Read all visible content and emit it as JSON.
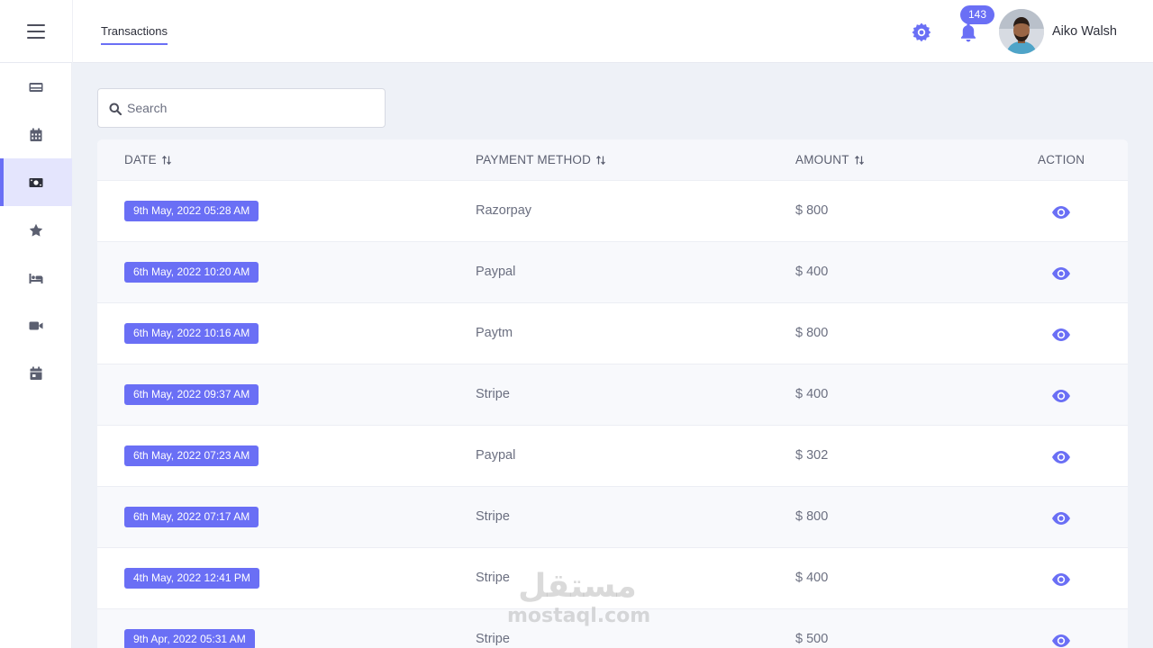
{
  "header": {
    "page_tab": "Transactions",
    "notification_count": "143",
    "user_name": "Aiko Walsh"
  },
  "sidebar": {
    "items": [
      {
        "icon": "credit-card-icon",
        "active": false
      },
      {
        "icon": "calendar-grid-icon",
        "active": false
      },
      {
        "icon": "money-icon",
        "active": true
      },
      {
        "icon": "star-icon",
        "active": false
      },
      {
        "icon": "bed-icon",
        "active": false
      },
      {
        "icon": "video-icon",
        "active": false
      },
      {
        "icon": "calendar-day-icon",
        "active": false
      }
    ]
  },
  "search": {
    "placeholder": "Search",
    "value": ""
  },
  "table": {
    "columns": [
      "DATE",
      "PAYMENT METHOD",
      "AMOUNT",
      "ACTION"
    ],
    "rows": [
      {
        "date": "9th May, 2022 05:28 AM",
        "method": "Razorpay",
        "amount": "$ 800"
      },
      {
        "date": "6th May, 2022 10:20 AM",
        "method": "Paypal",
        "amount": "$ 400"
      },
      {
        "date": "6th May, 2022 10:16 AM",
        "method": "Paytm",
        "amount": "$ 800"
      },
      {
        "date": "6th May, 2022 09:37 AM",
        "method": "Stripe",
        "amount": "$ 400"
      },
      {
        "date": "6th May, 2022 07:23 AM",
        "method": "Paypal",
        "amount": "$ 302"
      },
      {
        "date": "6th May, 2022 07:17 AM",
        "method": "Stripe",
        "amount": "$ 800"
      },
      {
        "date": "4th May, 2022 12:41 PM",
        "method": "Stripe",
        "amount": "$ 400"
      },
      {
        "date": "9th Apr, 2022 05:31 AM",
        "method": "Stripe",
        "amount": "$ 500"
      }
    ]
  },
  "watermark": {
    "arabic": "مستقل",
    "latin": "mostaql.com"
  },
  "colors": {
    "accent": "#6a6ff5",
    "background": "#eef1f7",
    "sidebar_active_bg": "#e4e5fd",
    "text": "#6b6f80"
  }
}
